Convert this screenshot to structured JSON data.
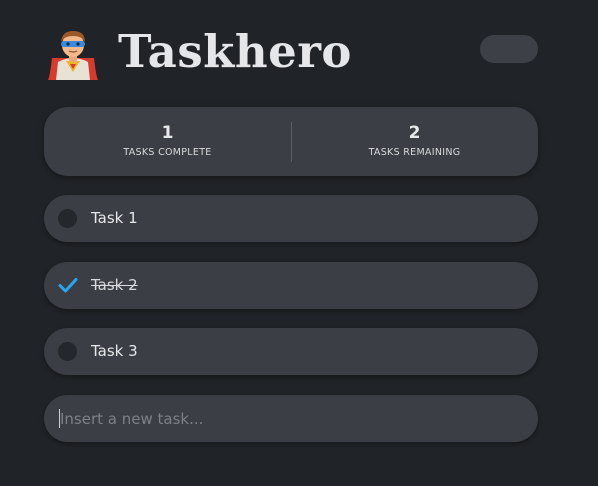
{
  "app": {
    "title": "Taskhero",
    "logo_icon": "superhero-emoji",
    "theme_toggle_icon": "moon-icon"
  },
  "stats": {
    "complete_value": "1",
    "complete_label": "TASKS COMPLETE",
    "remaining_value": "2",
    "remaining_label": "TASKS REMAINING"
  },
  "tasks": [
    {
      "label": "Task 1",
      "done": false
    },
    {
      "label": "Task 2",
      "done": true
    },
    {
      "label": "Task 3",
      "done": false
    }
  ],
  "new_task": {
    "placeholder": "Insert a new task...",
    "value": ""
  },
  "colors": {
    "background": "#202327",
    "card": "#3b3e44",
    "check": "#2aa5f0",
    "moon": "#f5b914"
  }
}
